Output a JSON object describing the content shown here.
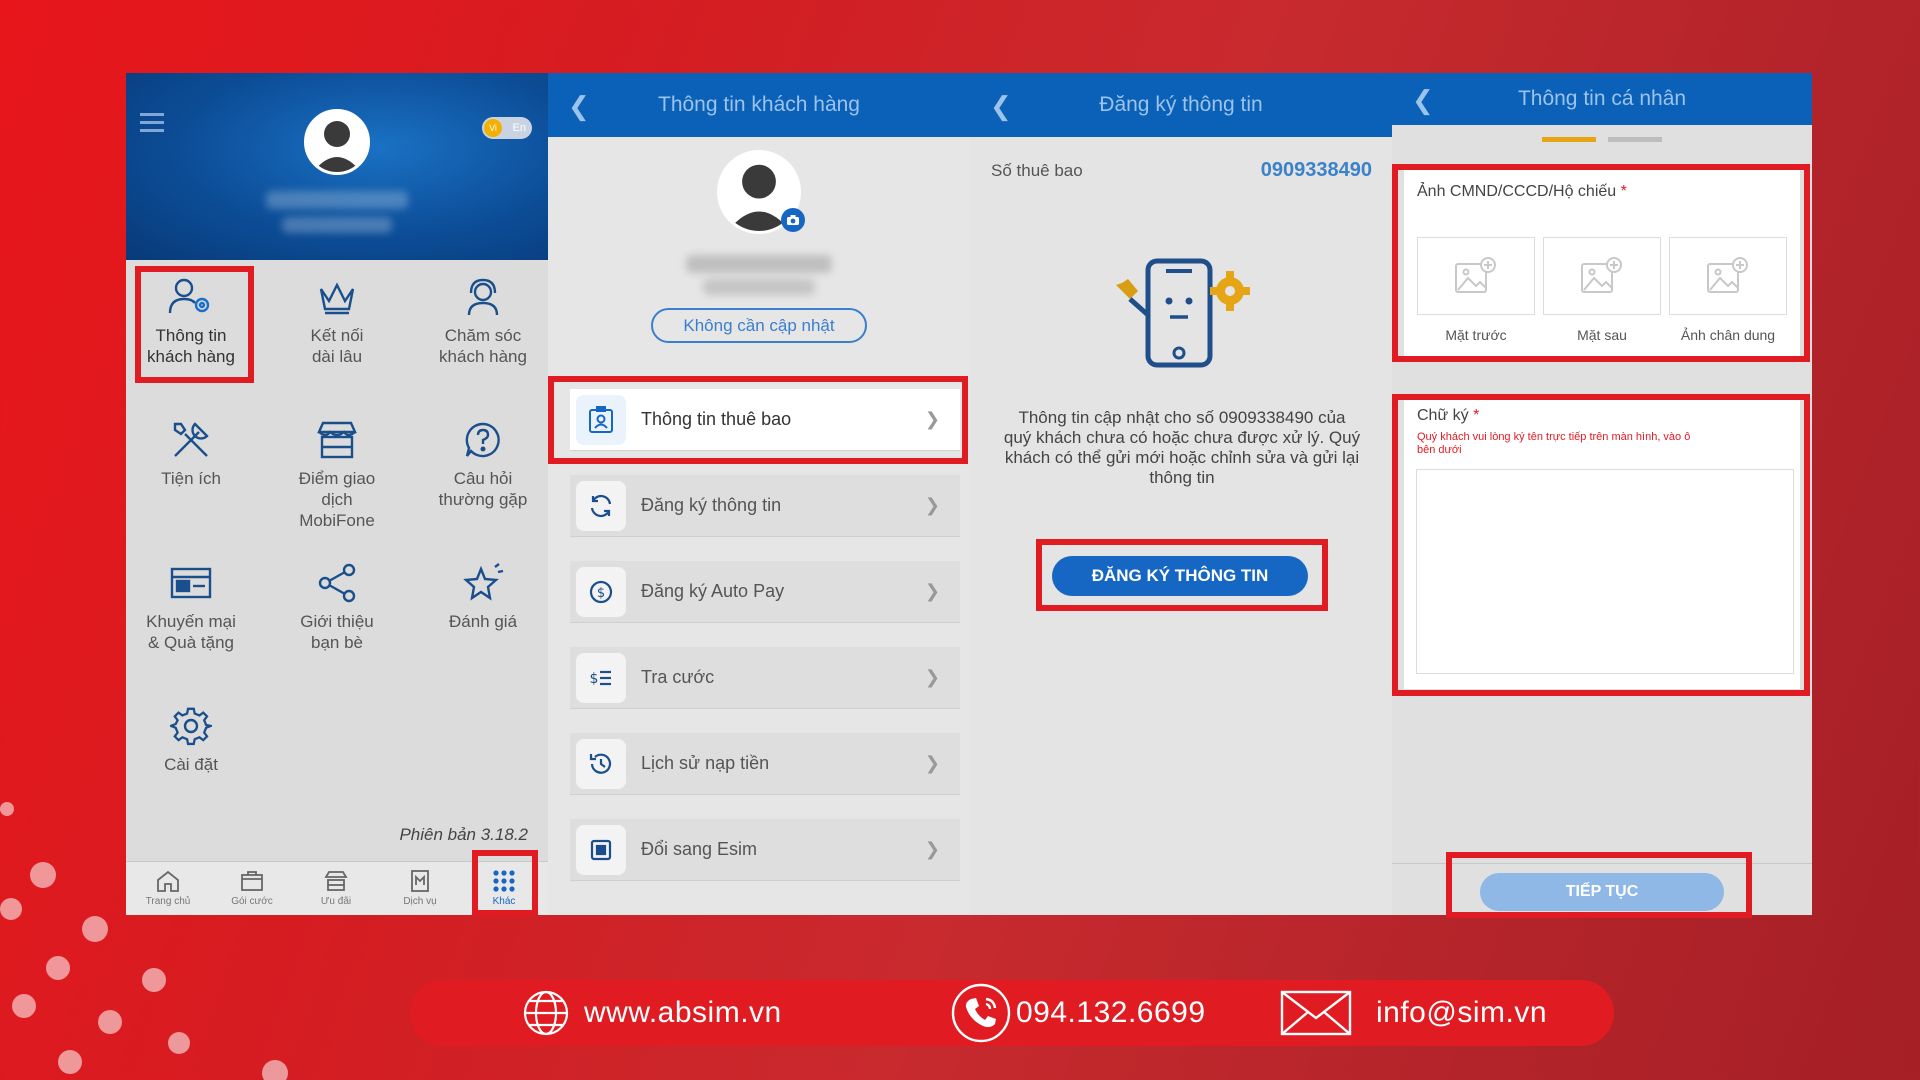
{
  "panel1": {
    "language_toggle": {
      "vi": "Vi",
      "en": "En"
    },
    "menu": [
      {
        "label_1": "Thông tin",
        "label_2": "khách hàng",
        "icon": "user-gear-icon"
      },
      {
        "label_1": "Kết nối",
        "label_2": "dài lâu",
        "icon": "crown-icon"
      },
      {
        "label_1": "Chăm sóc",
        "label_2": "khách hàng",
        "icon": "headset-icon"
      },
      {
        "label_1": "Tiện ích",
        "label_2": "",
        "icon": "tools-icon"
      },
      {
        "label_1": "Điểm giao",
        "label_2": "dịch",
        "label_3": "MobiFone",
        "icon": "store-icon"
      },
      {
        "label_1": "Câu hỏi",
        "label_2": "thường gặp",
        "icon": "question-icon"
      },
      {
        "label_1": "Khuyến mại",
        "label_2": "& Quà tặng",
        "icon": "gift-card-icon"
      },
      {
        "label_1": "Giới thiệu",
        "label_2": "bạn bè",
        "icon": "share-icon"
      },
      {
        "label_1": "Đánh giá",
        "label_2": "",
        "icon": "star-icon"
      },
      {
        "label_1": "Cài đặt",
        "label_2": "",
        "icon": "gear-icon"
      }
    ],
    "version": "Phiên bản 3.18.2",
    "tabs": [
      {
        "label": "Trang chủ",
        "icon": "home-icon"
      },
      {
        "label": "Gói cước",
        "icon": "package-icon"
      },
      {
        "label": "Ưu đãi",
        "icon": "offer-icon"
      },
      {
        "label": "Dịch vụ",
        "icon": "service-icon"
      },
      {
        "label": "Khác",
        "icon": "grid-dots-icon"
      }
    ]
  },
  "panel2": {
    "title": "Thông tin khách hàng",
    "status_pill": "Không cần cập nhật",
    "rows": [
      {
        "label": "Thông tin thuê bao",
        "icon": "id-card-icon"
      },
      {
        "label": "Đăng ký thông tin",
        "icon": "refresh-icon"
      },
      {
        "label": "Đăng ký Auto Pay",
        "icon": "dollar-cycle-icon"
      },
      {
        "label": "Tra cước",
        "icon": "bill-list-icon"
      },
      {
        "label": "Lịch sử nạp tiền",
        "icon": "history-icon"
      },
      {
        "label": "Đổi sang Esim",
        "icon": "sim-icon"
      }
    ]
  },
  "panel3": {
    "title": "Đăng ký thông tin",
    "subscriber_label": "Số thuê bao",
    "subscriber_number": "0909338490",
    "message_1": "Thông tin cập nhật cho số 0909338490 của",
    "message_2": "quý khách chưa có hoặc chưa được xử lý. Quý",
    "message_3": "khách có thể gửi mới hoặc chỉnh sửa và gửi lại",
    "message_4": "thông tin",
    "button": "ĐĂNG KÝ THÔNG TIN"
  },
  "panel4": {
    "title": "Thông tin cá nhân",
    "id_photo_label": "Ảnh CMND/CCCD/Hộ chiếu",
    "required_mark": "*",
    "photos": [
      "Mặt trước",
      "Mặt sau",
      "Ảnh chân dung"
    ],
    "signature_label": "Chữ ký",
    "signature_hint_1": "Quý khách vui lòng ký tên trực tiếp trên màn hình, vào ô",
    "signature_hint_2": "bên dưới",
    "next_button": "TIẾP TỤC"
  },
  "footer": {
    "website": "www.absim.vn",
    "phone": "094.132.6699",
    "email": "info@sim.vn"
  },
  "colors": {
    "brand_red": "#e11b22",
    "mobifone_blue": "#0b60b8",
    "accent_orange": "#f2b100"
  }
}
